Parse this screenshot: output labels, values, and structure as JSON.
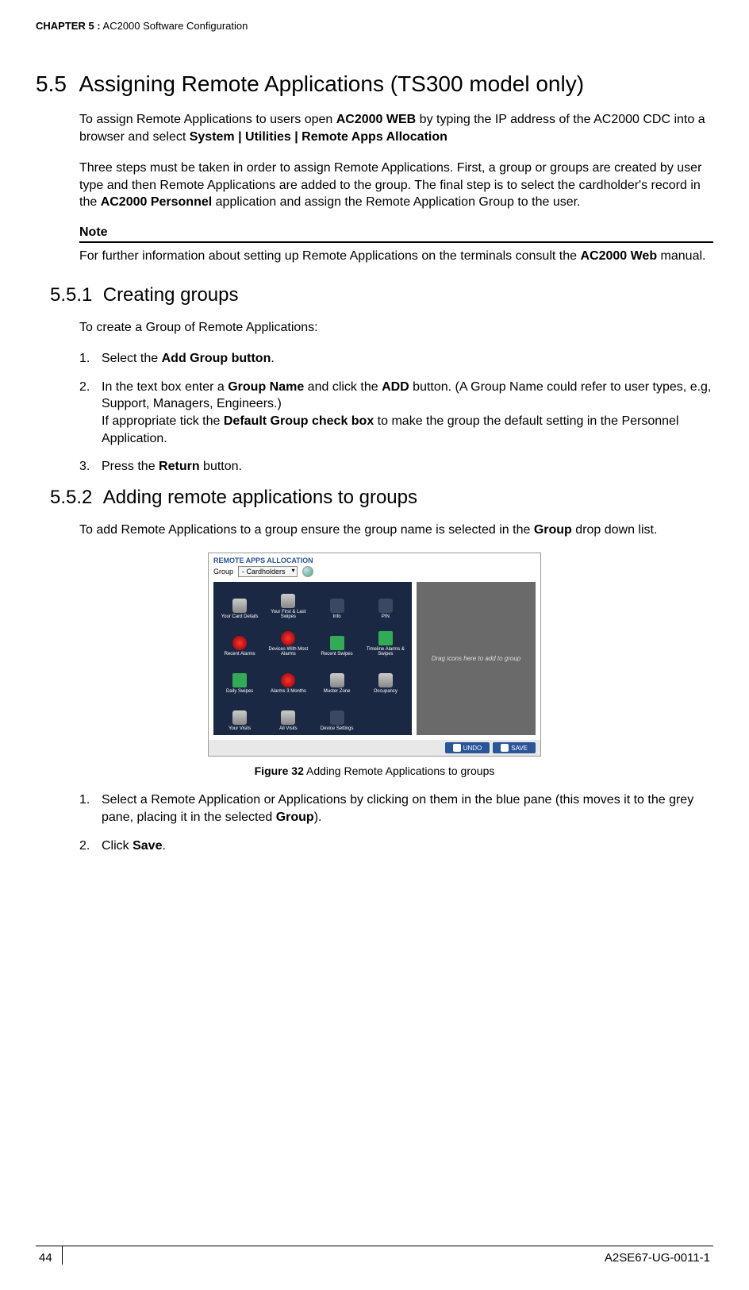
{
  "header": {
    "chapter": "CHAPTER 5 :",
    "title": "AC2000 Software Configuration"
  },
  "section": {
    "number": "5.5",
    "title": "Assigning Remote Applications (TS300 model only)",
    "para1_a": "To assign Remote Applications to users open ",
    "para1_b": "AC2000 WEB",
    "para1_c": " by typing the IP address of the AC2000 CDC into a browser and select ",
    "para1_d": "System | Utilities | Remote Apps Allocation",
    "para2_a": "Three steps must be taken in order to assign Remote Applications. First, a group or groups are created by user type and then Remote Applications are added to the group. The final step is to select the cardholder's record in the ",
    "para2_b": "AC2000 Personnel",
    "para2_c": " application and assign the Remote Application Group to the user.",
    "note_label": "Note",
    "note_a": "For further information about setting up Remote Applications on the terminals consult the ",
    "note_b": "AC2000 Web",
    "note_c": " manual."
  },
  "sub1": {
    "number": "5.5.1",
    "title": "Creating groups",
    "intro": "To create a Group of Remote Applications:",
    "items": [
      {
        "n": "1.",
        "a": "Select the ",
        "b": "Add Group button",
        "c": "."
      },
      {
        "n": "2.",
        "a": "In the text box enter a ",
        "b": "Group Name",
        "c": " and click the ",
        "d": "ADD",
        "e": " button. (A Group Name could refer to user types, e.g, Support, Managers, Engineers.)",
        "f": "If appropriate tick the ",
        "g": "Default Group check box",
        "h": " to make the group the default setting in the Personnel Application."
      },
      {
        "n": "3.",
        "a": "Press the ",
        "b": "Return",
        "c": " button."
      }
    ]
  },
  "sub2": {
    "number": "5.5.2",
    "title": "Adding remote applications to groups",
    "intro_a": "To add Remote Applications to a group ensure the group name is selected in the ",
    "intro_b": "Group",
    "intro_c": " drop down list.",
    "figure": {
      "header": "REMOTE APPS ALLOCATION",
      "group_label": "Group",
      "group_value": "- Cardholders",
      "tiles": [
        "Your Card Details",
        "Your First & Last Swipes",
        "Info",
        "PIN",
        "Recent Alarms",
        "Devices With Most Alarms",
        "Recent Swipes",
        "Timeline Alarms & Swipes",
        "Daily Swipes",
        "Alarms 3 Months",
        "Muster Zone",
        "Occupancy",
        "Your Visits",
        "All Visits",
        "Device Settings",
        ""
      ],
      "grey_text": "Drag icons here to add to group",
      "undo": "UNDO",
      "save": "SAVE"
    },
    "caption_label": "Figure 32",
    "caption_text": " Adding Remote Applications to groups",
    "items": [
      {
        "n": "1.",
        "a": "Select a Remote Application or Applications by clicking on them in the blue pane (this moves it to the grey pane, placing it in the selected ",
        "b": "Group",
        "c": ")."
      },
      {
        "n": "2.",
        "a": "Click ",
        "b": "Save",
        "c": "."
      }
    ]
  },
  "footer": {
    "page": "44",
    "docid": "A2SE67-UG-0011-1"
  }
}
